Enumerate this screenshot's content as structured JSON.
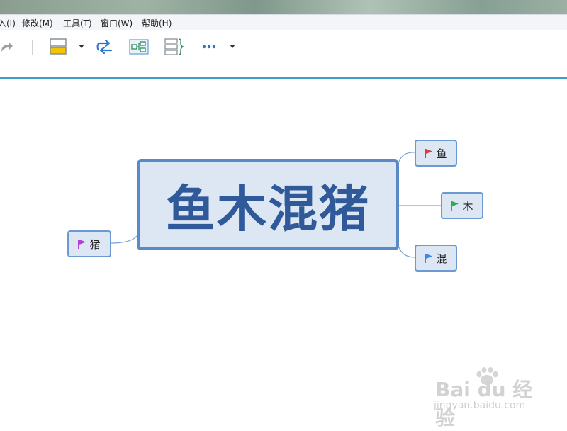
{
  "menu": {
    "items": [
      {
        "label": "入(I)"
      },
      {
        "label": "修改(M)"
      },
      {
        "label": "工具(T)"
      },
      {
        "label": "窗口(W)"
      },
      {
        "label": "帮助(H)"
      }
    ]
  },
  "toolbar": {
    "icons": [
      "redo-icon",
      "topic-style-icon",
      "relationship-icon",
      "structure-icon",
      "boundary-icon",
      "more-icon"
    ]
  },
  "mindmap": {
    "central": {
      "label": "鱼木混猪"
    },
    "topics": [
      {
        "label": "鱼",
        "flag_color": "#e03b3b"
      },
      {
        "label": "木",
        "flag_color": "#1fb34a"
      },
      {
        "label": "混",
        "flag_color": "#3f86e8"
      },
      {
        "label": "猪",
        "flag_color": "#b043d6"
      }
    ]
  },
  "watermark": {
    "brand": "Bai du 经验",
    "url": "jingyan.baidu.com"
  },
  "colors": {
    "accent": "#3d9ccc",
    "central_fill": "#dde6f3",
    "central_border": "#5a8ac6",
    "central_text": "#30599a"
  }
}
